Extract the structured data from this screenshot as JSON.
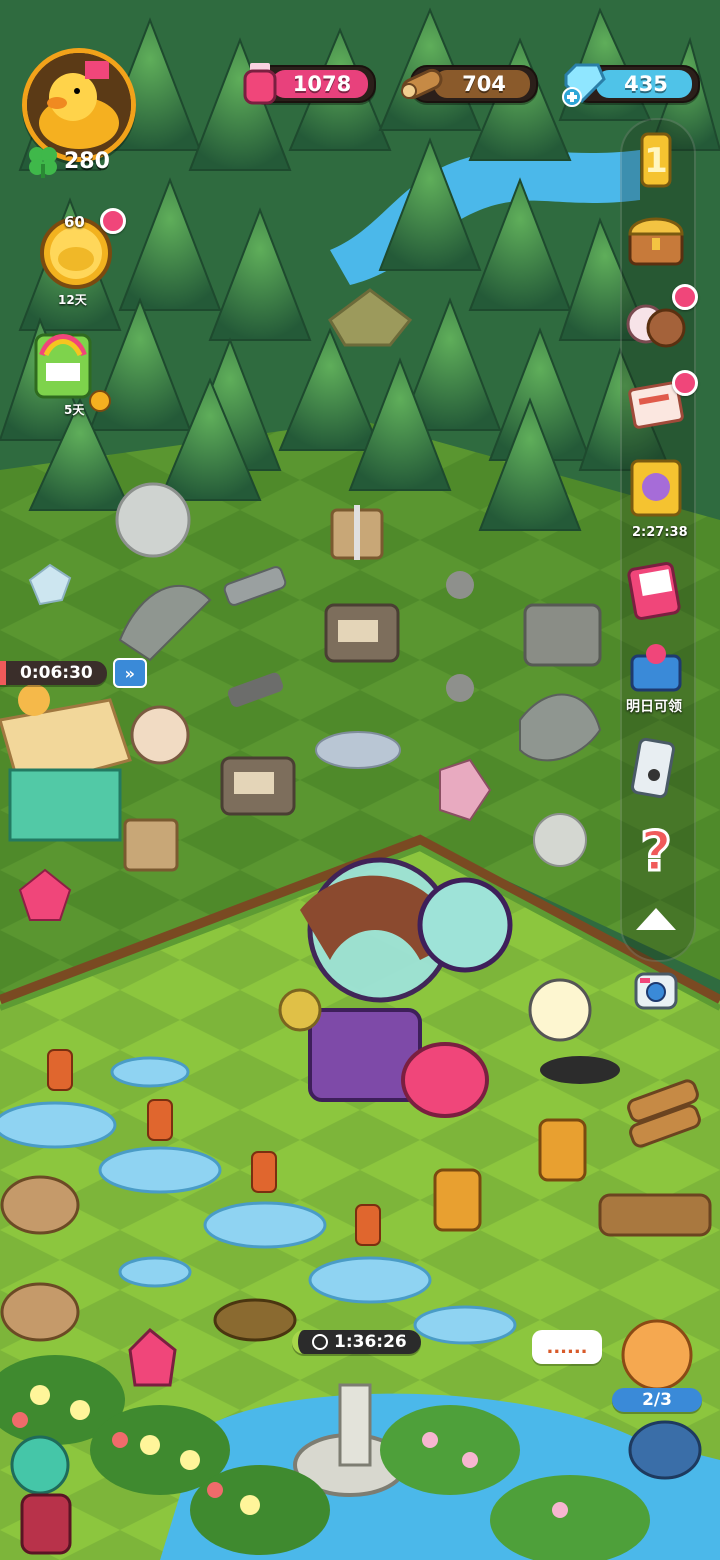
{
  "hud": {
    "player_clovers": "280",
    "resources": [
      {
        "name": "potion",
        "value": "1078",
        "color": "#e8417c",
        "icon": "pink-potion-icon"
      },
      {
        "name": "wood",
        "value": "704",
        "color": "#8a5a2b",
        "icon": "log-icon"
      },
      {
        "name": "gems",
        "value": "435",
        "color": "#4fc3e8",
        "icon": "blue-gem-icon"
      }
    ]
  },
  "left_events": [
    {
      "id": "golden-duck",
      "count": "60",
      "days": "12天",
      "icon": "golden-duck-icon"
    },
    {
      "id": "slot-machine",
      "days": "5天",
      "icon": "rainbow-slot-machine-icon"
    }
  ],
  "right_rail": [
    {
      "id": "rank",
      "icon": "number-one-trophy-icon"
    },
    {
      "id": "shop",
      "icon": "treasure-chest-icon"
    },
    {
      "id": "friends",
      "icon": "animal-friends-icon"
    },
    {
      "id": "news",
      "icon": "newspaper-icon"
    },
    {
      "id": "event-card",
      "timer": "2:27:38",
      "icon": "event-character-card-icon"
    },
    {
      "id": "album",
      "icon": "photo-album-icon"
    },
    {
      "id": "gift-machine",
      "label": "明日可领",
      "icon": "gift-machine-icon"
    },
    {
      "id": "phone",
      "icon": "phone-icon"
    },
    {
      "id": "help",
      "icon": "question-mark-icon"
    },
    {
      "id": "collapse",
      "icon": "up-arrow-icon"
    },
    {
      "id": "camera",
      "icon": "camera-icon"
    }
  ],
  "timers": {
    "shop_timer": "0:06:30",
    "fountain_timer": "1:36:26"
  },
  "map_note": {
    "speech_bubble": "......",
    "visitor_count": "2/3"
  },
  "colors": {
    "grass_light": "#8cc63e",
    "grass_dark": "#5d9b33",
    "forest": "#2f6b3f",
    "water": "#4bb8ea",
    "accent_pink": "#f0467a"
  }
}
